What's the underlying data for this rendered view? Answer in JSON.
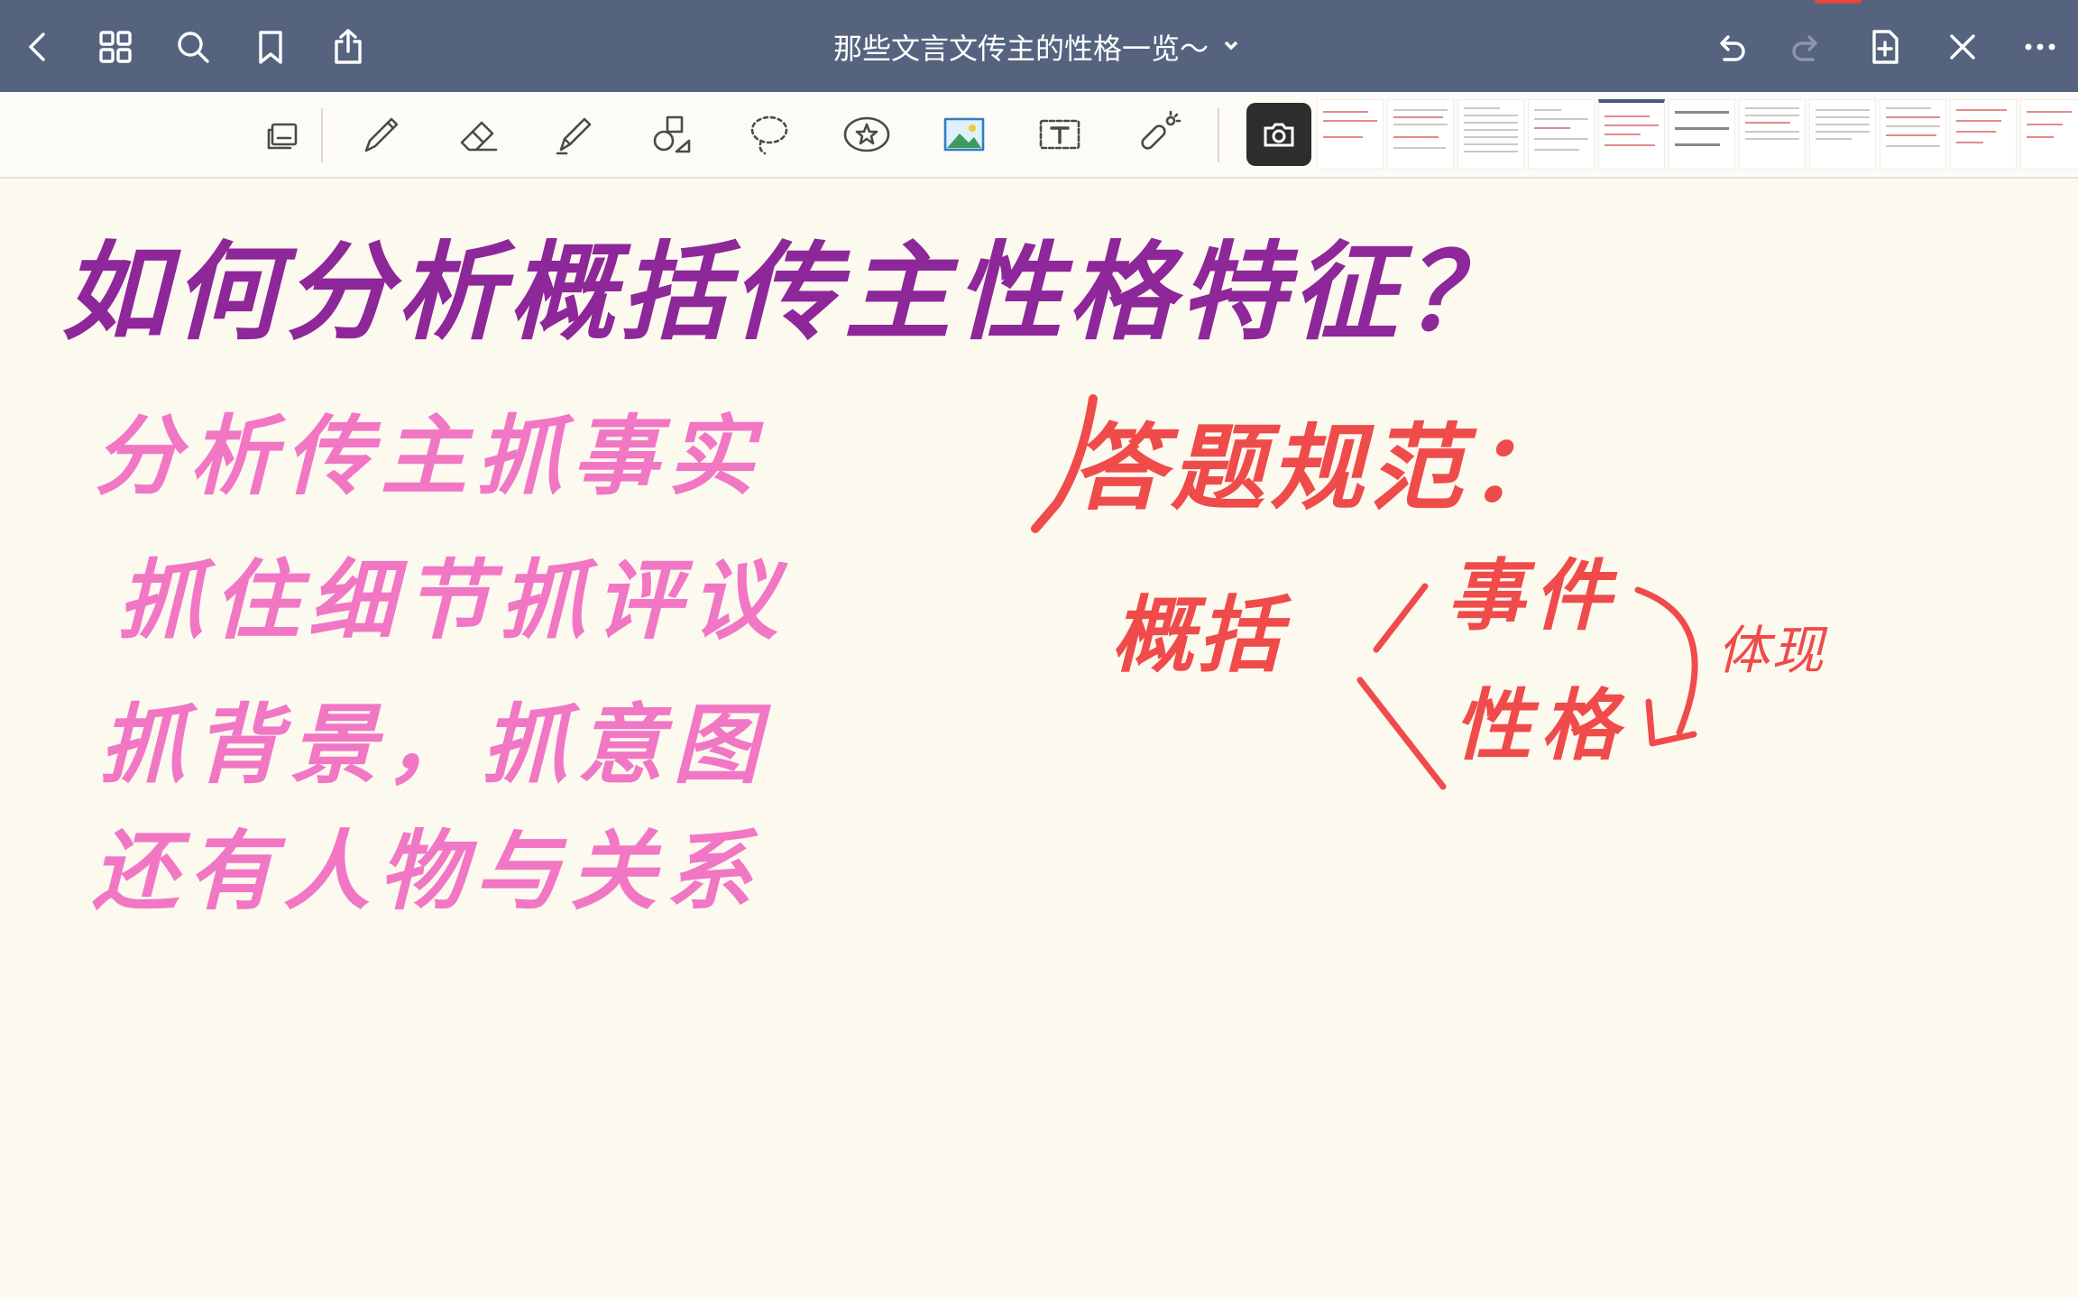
{
  "topbar": {
    "title": "那些文言文传主的性格一览～",
    "left_icons": [
      "back-icon",
      "grid-icon",
      "search-icon",
      "bookmark-icon",
      "share-icon"
    ],
    "right_icons": [
      "undo-icon",
      "redo-icon",
      "add-page-icon",
      "close-icon",
      "more-icon"
    ]
  },
  "toolbar": {
    "tools": [
      "page-layout-icon",
      "pen-icon",
      "eraser-icon",
      "highlighter-icon",
      "shapes-icon",
      "lasso-icon",
      "sticker-icon",
      "image-icon",
      "text-box-icon",
      "laser-pointer-icon"
    ],
    "active_tool": "camera-icon"
  },
  "notes": {
    "heading": "如何分析概括传主性格特征？",
    "pink_lines": [
      "分析传主抓事实",
      "抓住细节抓评议",
      "抓背景，抓意图",
      "还有人物与关系"
    ],
    "answer_title": "答题规范：",
    "summarize": "概括",
    "event": "事件",
    "personality": "性格",
    "embody": "体现"
  },
  "colors": {
    "topbar_bg": "#55637f",
    "canvas_bg": "#fcf9ef",
    "heading": "#8e2799",
    "pink": "#f177c5",
    "red": "#ef4b4b"
  }
}
